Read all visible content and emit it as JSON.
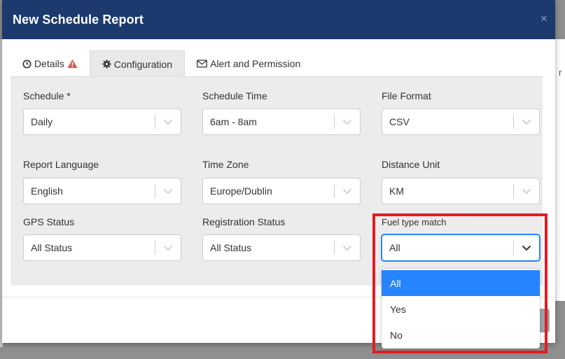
{
  "modal": {
    "title": "New Schedule Report",
    "close_glyph": "×"
  },
  "tabs": [
    {
      "label": "Details",
      "icon": "clock-icon",
      "warning_icon": "warning-icon",
      "active": false
    },
    {
      "label": "Configuration",
      "icon": "gear-icon",
      "active": true
    },
    {
      "label": "Alert and Permission",
      "icon": "envelope-icon",
      "active": false
    }
  ],
  "fields": {
    "schedule": {
      "label": "Schedule *",
      "value": "Daily"
    },
    "schedule_time": {
      "label": "Schedule Time",
      "value": "6am - 8am"
    },
    "file_format": {
      "label": "File Format",
      "value": "CSV"
    },
    "report_language": {
      "label": "Report Language",
      "value": "English"
    },
    "time_zone": {
      "label": "Time Zone",
      "value": "Europe/Dublin"
    },
    "distance_unit": {
      "label": "Distance Unit",
      "value": "KM"
    },
    "gps_status": {
      "label": "GPS Status",
      "value": "All Status"
    },
    "registration_status": {
      "label": "Registration Status",
      "value": "All Status"
    },
    "fuel_type_match": {
      "label": "Fuel type match",
      "value": "All",
      "options": [
        "All",
        "Yes",
        "No"
      ],
      "selected_index": 0
    }
  },
  "colors": {
    "header": "#1d3a6e",
    "accent": "#2684ff",
    "warning": "#d9534f",
    "highlight": "#e21b23"
  }
}
